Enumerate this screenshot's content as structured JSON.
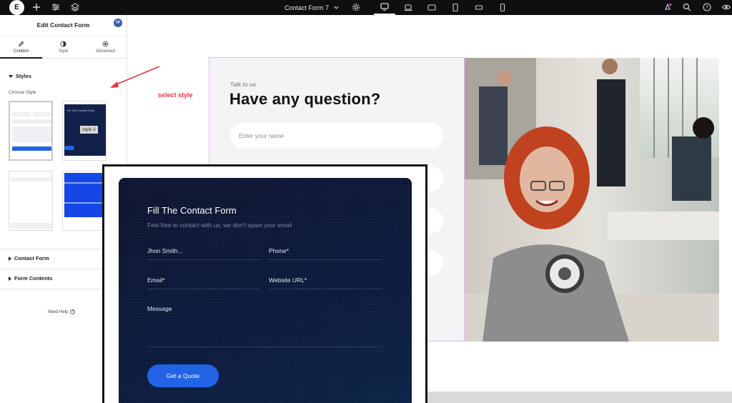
{
  "topbar": {
    "logo_text": "E",
    "document_title": "Contact Form 7",
    "icons": [
      "elementor-logo",
      "plus-icon",
      "sliders-icon",
      "layers-icon",
      "chevron-down-icon",
      "gear-icon",
      "desktop-icon",
      "laptop-icon",
      "tablet-landscape-icon",
      "tablet-portrait-icon",
      "mobile-landscape-icon",
      "mobile-portrait-icon",
      "notifications-icon",
      "search-icon",
      "help-icon",
      "preview-eye-icon"
    ]
  },
  "panel": {
    "title": "Edit Contact Form",
    "avatar_initials": "TP",
    "tabs": [
      {
        "label": "Content",
        "icon": "pencil-icon",
        "active": true
      },
      {
        "label": "Style",
        "icon": "contrast-icon",
        "active": false
      },
      {
        "label": "Advanced",
        "icon": "gear-icon",
        "active": false
      }
    ],
    "styles_section": "Styles",
    "choose_style_label": "Choose Style",
    "style2_tooltip": "style 2",
    "thumb2_heading": "Fill The Contact Form",
    "sections": [
      "Contact Form",
      "Form Contents"
    ],
    "need_help": "Need Help",
    "need_help_glyph": "?"
  },
  "annotation": {
    "text": "select style",
    "color": "#e0373f"
  },
  "preview": {
    "eyebrow": "Talk to us",
    "heading": "Have any question?",
    "name_placeholder": "Enter your name"
  },
  "overlay_form": {
    "title": "Fill The Contact Form",
    "subtitle": "Feel free to contact with us, we don't spam your email",
    "fields": [
      {
        "label": "Jhon Smith..."
      },
      {
        "label": "Phone*"
      },
      {
        "label": "Email*"
      },
      {
        "label": "Website URL*"
      },
      {
        "label": "Message"
      }
    ],
    "submit_label": "Get a Quote",
    "accent_color": "#2263e6"
  }
}
